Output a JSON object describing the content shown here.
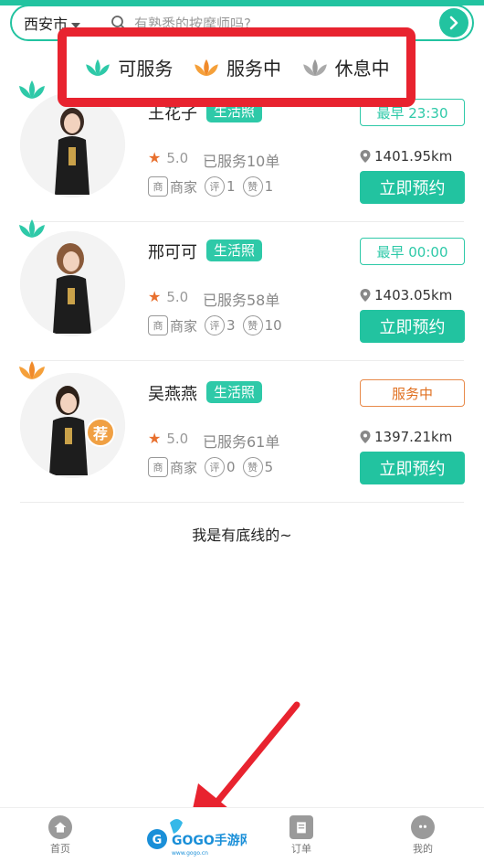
{
  "header": {
    "city": "西安市",
    "search_placeholder": "有熟悉的按摩师吗?"
  },
  "legend": [
    {
      "label": "可服务",
      "color": "#2ec9a8"
    },
    {
      "label": "服务中",
      "color": "#f08a2a"
    },
    {
      "label": "休息中",
      "color": "#a0a0a0"
    }
  ],
  "therapists": [
    {
      "name": "王花子",
      "tag": "生活照",
      "time_label": "最早 23:30",
      "rating": "5.0",
      "served": "已服务10单",
      "distance": "1401.95km",
      "merchant": "商家",
      "merchant_icon": "商",
      "reviews_icon": "评",
      "reviews": "1",
      "likes_icon": "赞",
      "likes": "1",
      "book": "立即预约",
      "status": "available"
    },
    {
      "name": "邢可可",
      "tag": "生活照",
      "time_label": "最早 00:00",
      "rating": "5.0",
      "served": "已服务58单",
      "distance": "1403.05km",
      "merchant": "商家",
      "merchant_icon": "商",
      "reviews_icon": "评",
      "reviews": "3",
      "likes_icon": "赞",
      "likes": "10",
      "book": "立即预约",
      "status": "available"
    },
    {
      "name": "吴燕燕",
      "tag": "生活照",
      "time_label": "服务中",
      "rating": "5.0",
      "served": "已服务61单",
      "distance": "1397.21km",
      "merchant": "商家",
      "merchant_icon": "商",
      "reviews_icon": "评",
      "reviews": "0",
      "likes_icon": "赞",
      "likes": "5",
      "book": "立即预约",
      "status": "busy",
      "recommend_badge": "荐"
    }
  ],
  "footer_text": "我是有底线的~",
  "tabs": [
    {
      "label": "首页",
      "icon": "home-icon"
    },
    {
      "label": "",
      "icon": "watermark-logo"
    },
    {
      "label": "订单",
      "icon": "order-icon"
    },
    {
      "label": "我的",
      "icon": "profile-icon"
    }
  ],
  "watermark": {
    "text": "GOGO手游网"
  }
}
